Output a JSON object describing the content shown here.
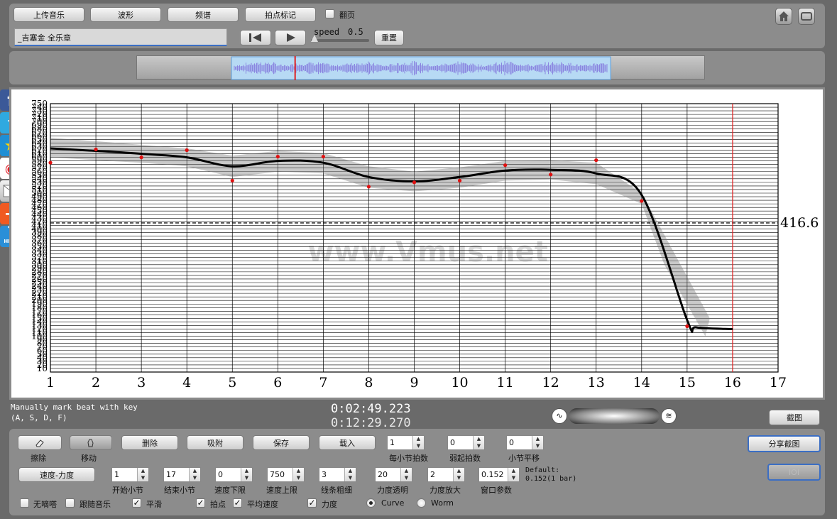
{
  "toolbar": {
    "upload_label": "上传音乐",
    "waveform_label": "波形",
    "spectrum_label": "频谱",
    "beat_mark_label": "拍点标记",
    "flip_page_label": "翻页",
    "flip_page_checked": false,
    "song_title": "_吉塞金 全乐章",
    "speed_label": "speed",
    "speed_value": "0.5",
    "speed_fraction": 0.0,
    "reset_label": "重置"
  },
  "timeline": {
    "view_start_fraction": 0.166,
    "view_end_fraction": 0.833,
    "playhead_fraction": 0.278
  },
  "chart_data": {
    "type": "line",
    "x_ticks": [
      1,
      2,
      3,
      4,
      5,
      6,
      7,
      8,
      9,
      10,
      11,
      12,
      13,
      14,
      15,
      16,
      17
    ],
    "y_ticks": [
      10,
      20,
      30,
      40,
      50,
      60,
      70,
      80,
      90,
      100,
      110,
      120,
      130,
      140,
      150,
      160,
      170,
      180,
      190,
      200,
      210,
      220,
      230,
      240,
      250,
      260,
      270,
      280,
      290,
      300,
      310,
      320,
      330,
      340,
      350,
      360,
      370,
      380,
      390,
      400,
      410,
      420,
      430,
      440,
      450,
      460,
      470,
      480,
      490,
      500,
      510,
      520,
      530,
      540,
      550,
      560,
      570,
      580,
      590,
      600,
      610,
      620,
      630,
      640,
      650,
      660,
      670,
      680,
      690,
      700,
      710,
      720,
      730,
      740,
      750
    ],
    "xlim": [
      1,
      17
    ],
    "ylim": [
      0,
      750
    ],
    "grid": true,
    "curve": [
      {
        "x": 1,
        "y": 625
      },
      {
        "x": 2,
        "y": 618
      },
      {
        "x": 3,
        "y": 610
      },
      {
        "x": 4,
        "y": 600
      },
      {
        "x": 5,
        "y": 575
      },
      {
        "x": 6,
        "y": 590
      },
      {
        "x": 7,
        "y": 585
      },
      {
        "x": 8,
        "y": 545
      },
      {
        "x": 9,
        "y": 533
      },
      {
        "x": 10,
        "y": 545
      },
      {
        "x": 11,
        "y": 563
      },
      {
        "x": 12,
        "y": 565
      },
      {
        "x": 13,
        "y": 555
      },
      {
        "x": 14,
        "y": 495
      },
      {
        "x": 15,
        "y": 145
      },
      {
        "x": 15.2,
        "y": 125
      },
      {
        "x": 16,
        "y": 120
      }
    ],
    "band_upper": [
      {
        "x": 1,
        "y": 655
      },
      {
        "x": 2,
        "y": 645
      },
      {
        "x": 3,
        "y": 635
      },
      {
        "x": 4,
        "y": 625
      },
      {
        "x": 5,
        "y": 605
      },
      {
        "x": 6,
        "y": 618
      },
      {
        "x": 7,
        "y": 612
      },
      {
        "x": 8,
        "y": 575
      },
      {
        "x": 9,
        "y": 560
      },
      {
        "x": 10,
        "y": 572
      },
      {
        "x": 11,
        "y": 590
      },
      {
        "x": 12,
        "y": 592
      },
      {
        "x": 13,
        "y": 585
      },
      {
        "x": 14,
        "y": 500
      },
      {
        "x": 15.5,
        "y": 150
      }
    ],
    "band_lower": [
      {
        "x": 15.4,
        "y": 100
      },
      {
        "x": 14.5,
        "y": 300
      },
      {
        "x": 14,
        "y": 470
      },
      {
        "x": 13,
        "y": 525
      },
      {
        "x": 12,
        "y": 538
      },
      {
        "x": 11,
        "y": 535
      },
      {
        "x": 10,
        "y": 515
      },
      {
        "x": 9,
        "y": 505
      },
      {
        "x": 8,
        "y": 515
      },
      {
        "x": 7,
        "y": 555
      },
      {
        "x": 6,
        "y": 560
      },
      {
        "x": 5,
        "y": 545
      },
      {
        "x": 4,
        "y": 575
      },
      {
        "x": 3,
        "y": 585
      },
      {
        "x": 2,
        "y": 592
      },
      {
        "x": 1,
        "y": 600
      }
    ],
    "beats": [
      {
        "x": 1,
        "y": 585
      },
      {
        "x": 2,
        "y": 622
      },
      {
        "x": 3,
        "y": 600
      },
      {
        "x": 4,
        "y": 620
      },
      {
        "x": 5,
        "y": 535
      },
      {
        "x": 6,
        "y": 602
      },
      {
        "x": 7,
        "y": 602
      },
      {
        "x": 8,
        "y": 518
      },
      {
        "x": 9,
        "y": 530
      },
      {
        "x": 10,
        "y": 535
      },
      {
        "x": 11,
        "y": 578
      },
      {
        "x": 12,
        "y": 552
      },
      {
        "x": 13,
        "y": 592
      },
      {
        "x": 14,
        "y": 478
      },
      {
        "x": 15,
        "y": 128
      }
    ],
    "average_value": 416.6,
    "average_label": "416.6",
    "cursor_x": 16,
    "watermark": "www.Vmus.net"
  },
  "status": {
    "hint_line1": "Manually mark beat with key",
    "hint_line2": "(A, S, D, F)",
    "current_time": "0:02:49.223",
    "total_time": "0:12:29.270",
    "screenshot_label": "截图"
  },
  "controls": {
    "erase_label": "擦除",
    "move_label": "移动",
    "delete_label": "删除",
    "attach_label": "吸附",
    "save_label": "保存",
    "load_label": "载入",
    "beats_per_bar": {
      "label": "每小节拍数",
      "value": "1"
    },
    "pickup_beats": {
      "label": "弱起拍数",
      "value": "0"
    },
    "bar_shift": {
      "label": "小节平移",
      "value": "0"
    },
    "share_label": "分享截图",
    "mode_label": "速度-力度",
    "start_bar": {
      "label": "开始小节",
      "value": "1"
    },
    "end_bar": {
      "label": "结束小节",
      "value": "17"
    },
    "speed_min": {
      "label": "速度下限",
      "value": "0"
    },
    "speed_max": {
      "label": "速度上限",
      "value": "750"
    },
    "line_width": {
      "label": "线条粗细",
      "value": "3"
    },
    "dyn_alpha": {
      "label": "力度透明",
      "value": "20"
    },
    "dyn_scale": {
      "label": "力度放大",
      "value": "2"
    },
    "window_param": {
      "label": "窗口参数",
      "value": "0.152"
    },
    "default_line1": "Default:",
    "default_line2": "0.152(1 bar)",
    "ioi_label": "IOI",
    "no_metronome": {
      "label": "无嘀嗒",
      "checked": false
    },
    "follow_music": {
      "label": "跟随音乐",
      "checked": false
    },
    "smooth": {
      "label": "平滑",
      "checked": true
    },
    "beat_points": {
      "label": "拍点",
      "checked": true
    },
    "avg_speed": {
      "label": "平均速度",
      "checked": true
    },
    "dynamics": {
      "label": "力度",
      "checked": true
    },
    "curve_opt": {
      "label": "Curve",
      "selected": true
    },
    "worm_opt": {
      "label": "Worm",
      "selected": false
    }
  },
  "colors": {
    "accent_blue": "#3b6ec4",
    "waveform": "#8a84e0",
    "beat_red": "#e01010",
    "cursor_red": "#e02020"
  }
}
